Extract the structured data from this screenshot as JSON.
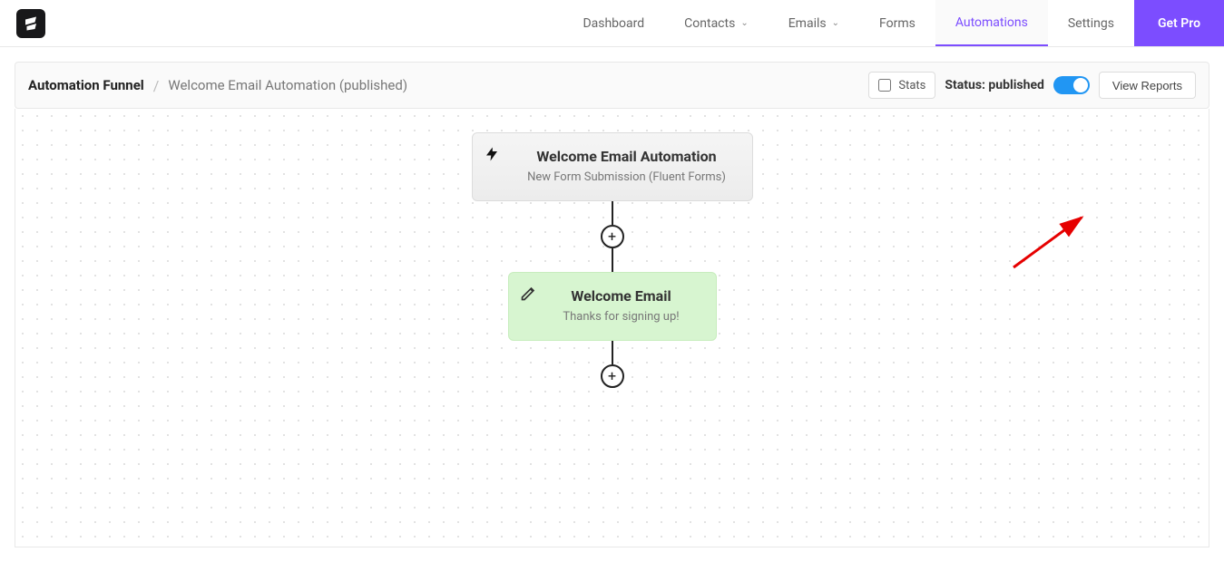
{
  "nav": {
    "dashboard": "Dashboard",
    "contacts": "Contacts",
    "emails": "Emails",
    "forms": "Forms",
    "automations": "Automations",
    "settings": "Settings",
    "getpro": "Get Pro"
  },
  "toolbar": {
    "crumb_root": "Automation Funnel",
    "crumb_current": "Welcome Email Automation (published)",
    "stats_label": "Stats",
    "status_label": "Status: published",
    "view_reports": "View Reports"
  },
  "flow": {
    "trigger": {
      "title": "Welcome Email Automation",
      "subtitle": "New Form Submission (Fluent Forms)"
    },
    "email": {
      "title": "Welcome Email",
      "subtitle": "Thanks for signing up!"
    }
  }
}
